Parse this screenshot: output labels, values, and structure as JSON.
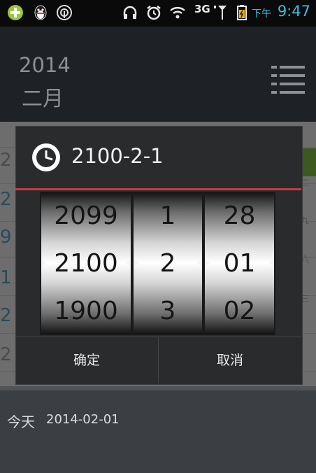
{
  "status_bar": {
    "network": "3G",
    "time_period": "下午",
    "time": "9:47",
    "icons": [
      "plus-circle-icon",
      "qq-penguin-icon",
      "broadcast-icon",
      "headphones-icon",
      "alarm-clock-icon",
      "wifi-icon",
      "signal-icon",
      "battery-icon"
    ]
  },
  "header": {
    "year": "2014",
    "month": "二月",
    "menu_icon": "menu-list-icon"
  },
  "dialog": {
    "title": "2100-2-1",
    "title_icon": "clock-icon",
    "accent_color": "#c93b3b",
    "year_wheel": [
      "2099",
      "2100",
      "1900"
    ],
    "month_wheel": [
      "1",
      "2",
      "3"
    ],
    "day_wheel": [
      "28",
      "01",
      "02"
    ],
    "confirm_label": "确定",
    "cancel_label": "取消"
  },
  "background_calendar": {
    "left_digits": [
      "2",
      "2",
      "9",
      "1",
      "2",
      "2"
    ],
    "right_fragments": [
      "二",
      "九",
      "六",
      "三"
    ]
  },
  "today": {
    "label": "今天",
    "date": "2014-02-01"
  }
}
